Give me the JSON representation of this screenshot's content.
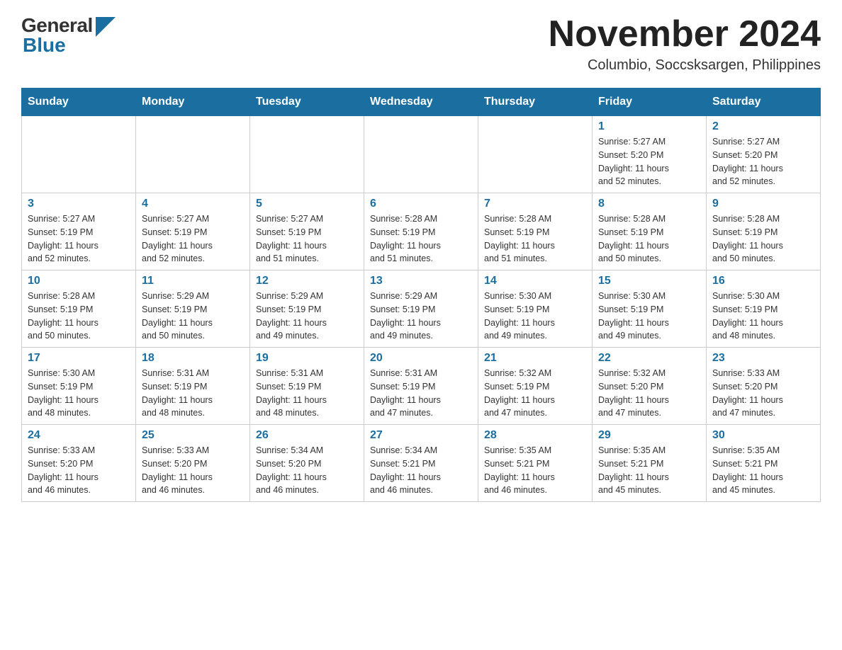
{
  "header": {
    "logo_general": "General",
    "logo_blue": "Blue",
    "month_title": "November 2024",
    "location": "Columbio, Soccsksargen, Philippines"
  },
  "weekdays": [
    "Sunday",
    "Monday",
    "Tuesday",
    "Wednesday",
    "Thursday",
    "Friday",
    "Saturday"
  ],
  "weeks": [
    [
      {
        "day": "",
        "info": ""
      },
      {
        "day": "",
        "info": ""
      },
      {
        "day": "",
        "info": ""
      },
      {
        "day": "",
        "info": ""
      },
      {
        "day": "",
        "info": ""
      },
      {
        "day": "1",
        "info": "Sunrise: 5:27 AM\nSunset: 5:20 PM\nDaylight: 11 hours\nand 52 minutes."
      },
      {
        "day": "2",
        "info": "Sunrise: 5:27 AM\nSunset: 5:20 PM\nDaylight: 11 hours\nand 52 minutes."
      }
    ],
    [
      {
        "day": "3",
        "info": "Sunrise: 5:27 AM\nSunset: 5:19 PM\nDaylight: 11 hours\nand 52 minutes."
      },
      {
        "day": "4",
        "info": "Sunrise: 5:27 AM\nSunset: 5:19 PM\nDaylight: 11 hours\nand 52 minutes."
      },
      {
        "day": "5",
        "info": "Sunrise: 5:27 AM\nSunset: 5:19 PM\nDaylight: 11 hours\nand 51 minutes."
      },
      {
        "day": "6",
        "info": "Sunrise: 5:28 AM\nSunset: 5:19 PM\nDaylight: 11 hours\nand 51 minutes."
      },
      {
        "day": "7",
        "info": "Sunrise: 5:28 AM\nSunset: 5:19 PM\nDaylight: 11 hours\nand 51 minutes."
      },
      {
        "day": "8",
        "info": "Sunrise: 5:28 AM\nSunset: 5:19 PM\nDaylight: 11 hours\nand 50 minutes."
      },
      {
        "day": "9",
        "info": "Sunrise: 5:28 AM\nSunset: 5:19 PM\nDaylight: 11 hours\nand 50 minutes."
      }
    ],
    [
      {
        "day": "10",
        "info": "Sunrise: 5:28 AM\nSunset: 5:19 PM\nDaylight: 11 hours\nand 50 minutes."
      },
      {
        "day": "11",
        "info": "Sunrise: 5:29 AM\nSunset: 5:19 PM\nDaylight: 11 hours\nand 50 minutes."
      },
      {
        "day": "12",
        "info": "Sunrise: 5:29 AM\nSunset: 5:19 PM\nDaylight: 11 hours\nand 49 minutes."
      },
      {
        "day": "13",
        "info": "Sunrise: 5:29 AM\nSunset: 5:19 PM\nDaylight: 11 hours\nand 49 minutes."
      },
      {
        "day": "14",
        "info": "Sunrise: 5:30 AM\nSunset: 5:19 PM\nDaylight: 11 hours\nand 49 minutes."
      },
      {
        "day": "15",
        "info": "Sunrise: 5:30 AM\nSunset: 5:19 PM\nDaylight: 11 hours\nand 49 minutes."
      },
      {
        "day": "16",
        "info": "Sunrise: 5:30 AM\nSunset: 5:19 PM\nDaylight: 11 hours\nand 48 minutes."
      }
    ],
    [
      {
        "day": "17",
        "info": "Sunrise: 5:30 AM\nSunset: 5:19 PM\nDaylight: 11 hours\nand 48 minutes."
      },
      {
        "day": "18",
        "info": "Sunrise: 5:31 AM\nSunset: 5:19 PM\nDaylight: 11 hours\nand 48 minutes."
      },
      {
        "day": "19",
        "info": "Sunrise: 5:31 AM\nSunset: 5:19 PM\nDaylight: 11 hours\nand 48 minutes."
      },
      {
        "day": "20",
        "info": "Sunrise: 5:31 AM\nSunset: 5:19 PM\nDaylight: 11 hours\nand 47 minutes."
      },
      {
        "day": "21",
        "info": "Sunrise: 5:32 AM\nSunset: 5:19 PM\nDaylight: 11 hours\nand 47 minutes."
      },
      {
        "day": "22",
        "info": "Sunrise: 5:32 AM\nSunset: 5:20 PM\nDaylight: 11 hours\nand 47 minutes."
      },
      {
        "day": "23",
        "info": "Sunrise: 5:33 AM\nSunset: 5:20 PM\nDaylight: 11 hours\nand 47 minutes."
      }
    ],
    [
      {
        "day": "24",
        "info": "Sunrise: 5:33 AM\nSunset: 5:20 PM\nDaylight: 11 hours\nand 46 minutes."
      },
      {
        "day": "25",
        "info": "Sunrise: 5:33 AM\nSunset: 5:20 PM\nDaylight: 11 hours\nand 46 minutes."
      },
      {
        "day": "26",
        "info": "Sunrise: 5:34 AM\nSunset: 5:20 PM\nDaylight: 11 hours\nand 46 minutes."
      },
      {
        "day": "27",
        "info": "Sunrise: 5:34 AM\nSunset: 5:21 PM\nDaylight: 11 hours\nand 46 minutes."
      },
      {
        "day": "28",
        "info": "Sunrise: 5:35 AM\nSunset: 5:21 PM\nDaylight: 11 hours\nand 46 minutes."
      },
      {
        "day": "29",
        "info": "Sunrise: 5:35 AM\nSunset: 5:21 PM\nDaylight: 11 hours\nand 45 minutes."
      },
      {
        "day": "30",
        "info": "Sunrise: 5:35 AM\nSunset: 5:21 PM\nDaylight: 11 hours\nand 45 minutes."
      }
    ]
  ]
}
